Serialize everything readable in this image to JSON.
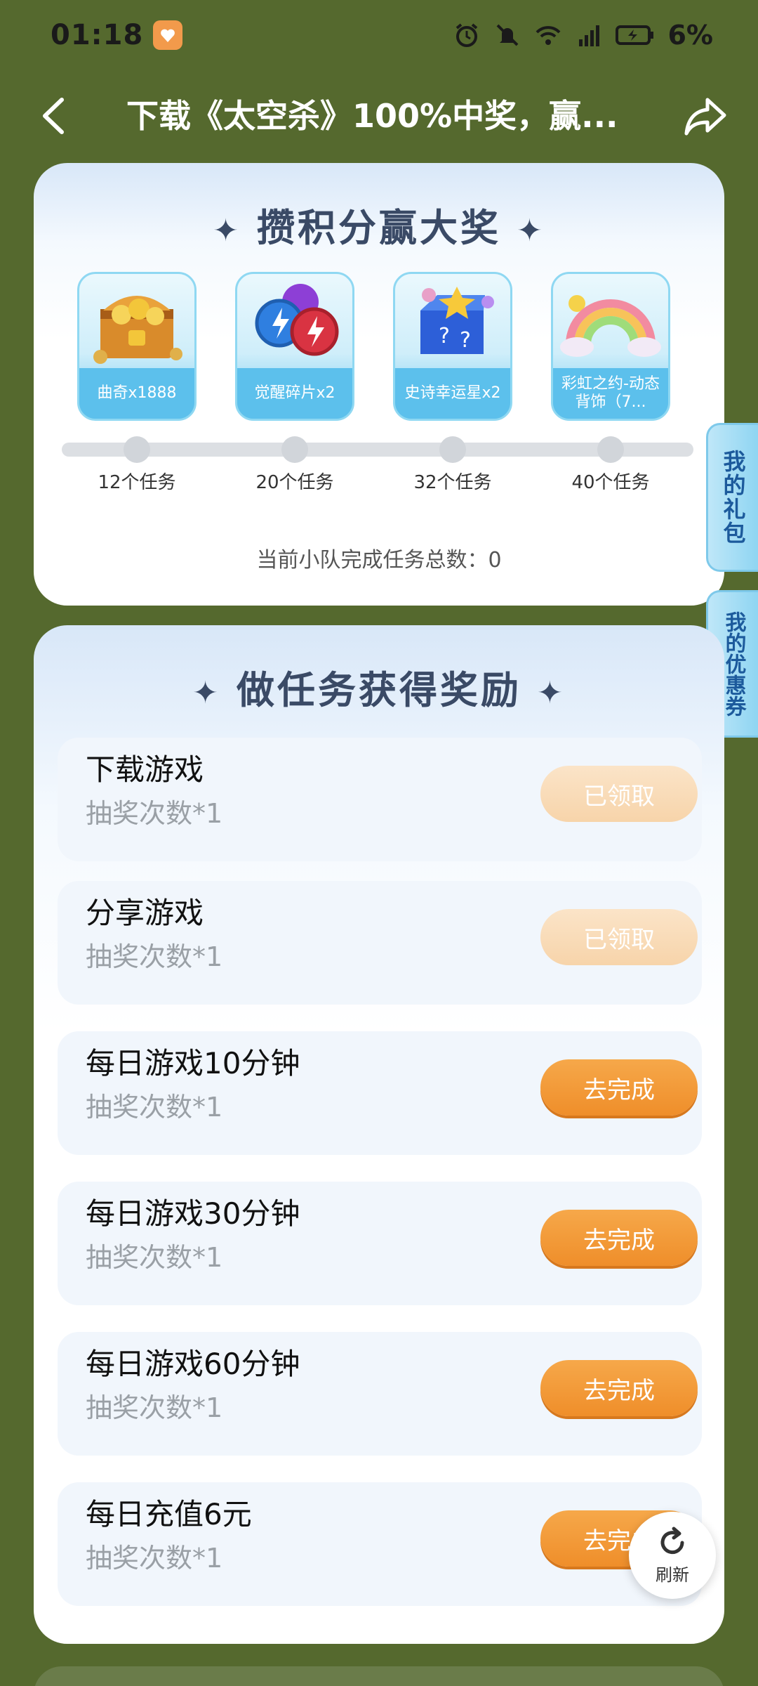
{
  "status_bar": {
    "time": "01:18",
    "battery": "6%",
    "icons": [
      "alarm-icon",
      "mute-icon",
      "wifi-icon",
      "signal-5g-icon",
      "battery-icon"
    ]
  },
  "nav": {
    "title": "下载《太空杀》100%中奖，赢..."
  },
  "rewards_card": {
    "title": "攒积分赢大奖",
    "prizes": [
      {
        "name": "曲奇x1888",
        "milestone": "12个任务"
      },
      {
        "name": "觉醒碎片x2",
        "milestone": "20个任务"
      },
      {
        "name": "史诗幸运星x2",
        "milestone": "32个任务"
      },
      {
        "name": "彩虹之约-动态背饰（7...",
        "milestone": "40个任务"
      }
    ],
    "progress": 0,
    "team_count_text": "当前小队完成任务总数：0"
  },
  "side_tabs": {
    "gift": "我的礼包",
    "coupon": "我的优惠券"
  },
  "tasks_card": {
    "title": "做任务获得奖励",
    "tasks": [
      {
        "name": "下载游戏",
        "reward": "抽奖次数*1",
        "button": "已领取",
        "state": "claimed"
      },
      {
        "name": "分享游戏",
        "reward": "抽奖次数*1",
        "button": "已领取",
        "state": "claimed"
      },
      {
        "name": "每日游戏10分钟",
        "reward": "抽奖次数*1",
        "button": "去完成",
        "state": "todo"
      },
      {
        "name": "每日游戏30分钟",
        "reward": "抽奖次数*1",
        "button": "去完成",
        "state": "todo"
      },
      {
        "name": "每日游戏60分钟",
        "reward": "抽奖次数*1",
        "button": "去完成",
        "state": "todo"
      },
      {
        "name": "每日充值6元",
        "reward": "抽奖次数*1",
        "button": "去完成",
        "state": "todo"
      }
    ]
  },
  "refresh": {
    "label": "刷新"
  },
  "colors": {
    "background": "#55692e",
    "accent_orange": "#ef8e2a",
    "claimed": "#f7d4aa",
    "side_tab": "#8fd5f2"
  }
}
